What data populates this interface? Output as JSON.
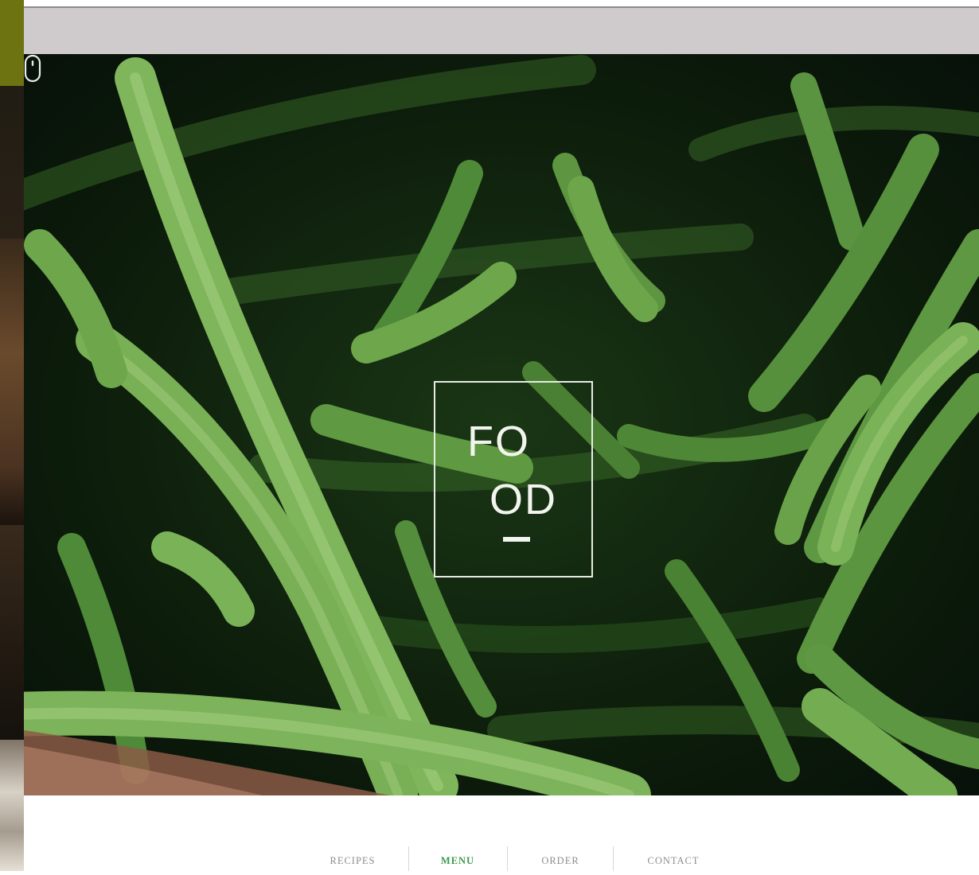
{
  "logo": {
    "line1": "FO",
    "line2": "OD",
    "dash": "—"
  },
  "nav": {
    "items": [
      {
        "label": "RECIPES",
        "active": false
      },
      {
        "label": "MENU",
        "active": true
      },
      {
        "label": "ORDER",
        "active": false
      },
      {
        "label": "CONTACT",
        "active": false
      }
    ]
  },
  "icons": {
    "scroll": "mouse-scroll-icon"
  },
  "colors": {
    "header_bar": "#cfcacb",
    "active_nav": "#3f9a4f",
    "inactive_nav": "#8d8d8d",
    "hero_dark": "#0b1a0a",
    "bean_green": "#6a9f4a"
  }
}
